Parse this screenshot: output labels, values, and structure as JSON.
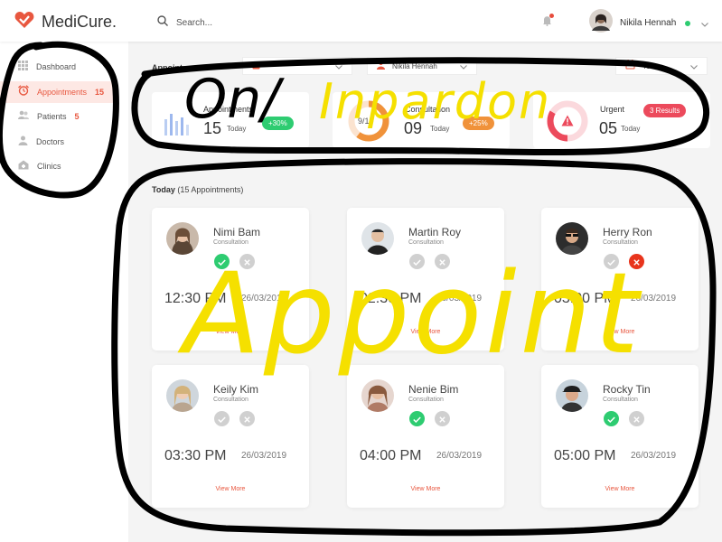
{
  "app": {
    "name": "MediCure."
  },
  "search": {
    "placeholder": "Search..."
  },
  "user": {
    "name": "Nikila Hennah"
  },
  "sidebar": {
    "items": [
      {
        "label": "Dashboard",
        "count": ""
      },
      {
        "label": "Appointments",
        "count": "15"
      },
      {
        "label": "Patients",
        "count": "5"
      },
      {
        "label": "Doctors",
        "count": ""
      },
      {
        "label": "Clinics",
        "count": ""
      }
    ]
  },
  "filters": {
    "title": "Appointments",
    "doctor": "Nikila Hennah",
    "date": "Today"
  },
  "stats": [
    {
      "title": "Appointments",
      "number": "15",
      "sub": "Today",
      "badge": "+30%"
    },
    {
      "title": "Consultation",
      "number": "09",
      "sub": "Today",
      "badge": "+25%",
      "gauge_text": "9/15"
    },
    {
      "title": "Urgent",
      "number": "05",
      "sub": "Today",
      "badge": "3 Results"
    }
  ],
  "section": {
    "title": "Today",
    "count": "(15 Appointments)"
  },
  "appointments": [
    {
      "name": "Nimi Bam",
      "type": "Consultation",
      "time": "12:30 PM",
      "date": "26/03/2019",
      "status": "accepted",
      "link": "View More"
    },
    {
      "name": "Martin Roy",
      "type": "Consultation",
      "time": "02:30 PM",
      "date": "26/03/2019",
      "status": "pending",
      "link": "View More"
    },
    {
      "name": "Herry Ron",
      "type": "Consultation",
      "time": "03:00 PM",
      "date": "26/03/2019",
      "status": "rejected",
      "link": "View More"
    },
    {
      "name": "Keily Kim",
      "type": "Consultation",
      "time": "03:30 PM",
      "date": "26/03/2019",
      "status": "pending",
      "link": "View More"
    },
    {
      "name": "Nenie Bim",
      "type": "Consultation",
      "time": "04:00 PM",
      "date": "26/03/2019",
      "status": "accepted",
      "link": "View More"
    },
    {
      "name": "Rocky Tin",
      "type": "Consultation",
      "time": "05:00 PM",
      "date": "26/03/2019",
      "status": "accepted",
      "link": "View More"
    }
  ],
  "annotations": {
    "top_black": "On/",
    "top_yellow": "Inpardon",
    "bottom_yellow": "Appoint"
  },
  "colors": {
    "accent": "#e8573f",
    "accept": "#2ecc71",
    "reject": "#e8341c",
    "neutral_action": "#d0d0d0",
    "marker_black": "#000000",
    "marker_yellow": "#f5e000"
  }
}
